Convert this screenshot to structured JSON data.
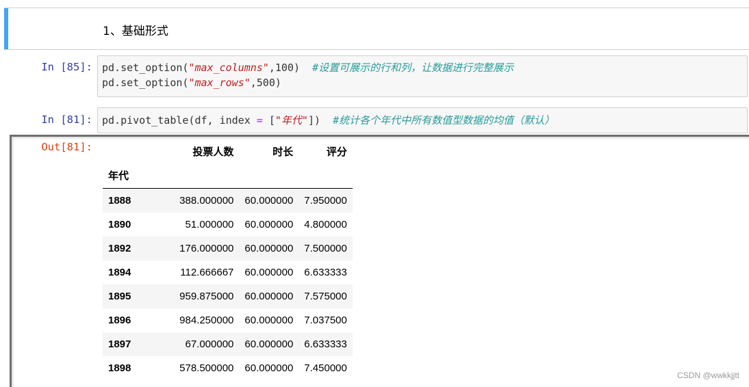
{
  "markdown_cell": {
    "text": "1、基础形式"
  },
  "cell1": {
    "prompt": "In  [85]:",
    "line1": {
      "a": "pd.set_option(",
      "str": "\"max_columns\"",
      "b": ",100)  ",
      "comment": "#设置可展示的行和列，让数据进行完整展示"
    },
    "line2": {
      "a": "pd.set_option(",
      "str": "\"max_rows\"",
      "b": ",500)"
    }
  },
  "cell2": {
    "prompt": "In  [81]:",
    "line1": {
      "a": "pd.pivot_table(df, index ",
      "op": "=",
      "b": " [",
      "str": "\"年代\"",
      "c": "])  ",
      "comment": "#统计各个年代中所有数值型数据的均值（默认）"
    }
  },
  "output": {
    "prompt": "Out[81]:",
    "table": {
      "columns": [
        "投票人数",
        "时长",
        "评分"
      ],
      "index_name": "年代",
      "rows": [
        {
          "index": "1888",
          "values": [
            "388.000000",
            "60.000000",
            "7.950000"
          ]
        },
        {
          "index": "1890",
          "values": [
            "51.000000",
            "60.000000",
            "4.800000"
          ]
        },
        {
          "index": "1892",
          "values": [
            "176.000000",
            "60.000000",
            "7.500000"
          ]
        },
        {
          "index": "1894",
          "values": [
            "112.666667",
            "60.000000",
            "6.633333"
          ]
        },
        {
          "index": "1895",
          "values": [
            "959.875000",
            "60.000000",
            "7.575000"
          ]
        },
        {
          "index": "1896",
          "values": [
            "984.250000",
            "60.000000",
            "7.037500"
          ]
        },
        {
          "index": "1897",
          "values": [
            "67.000000",
            "60.000000",
            "6.633333"
          ]
        },
        {
          "index": "1898",
          "values": [
            "578.500000",
            "60.000000",
            "7.450000"
          ]
        }
      ]
    }
  },
  "watermark": "CSDN @wwkkjjtt"
}
